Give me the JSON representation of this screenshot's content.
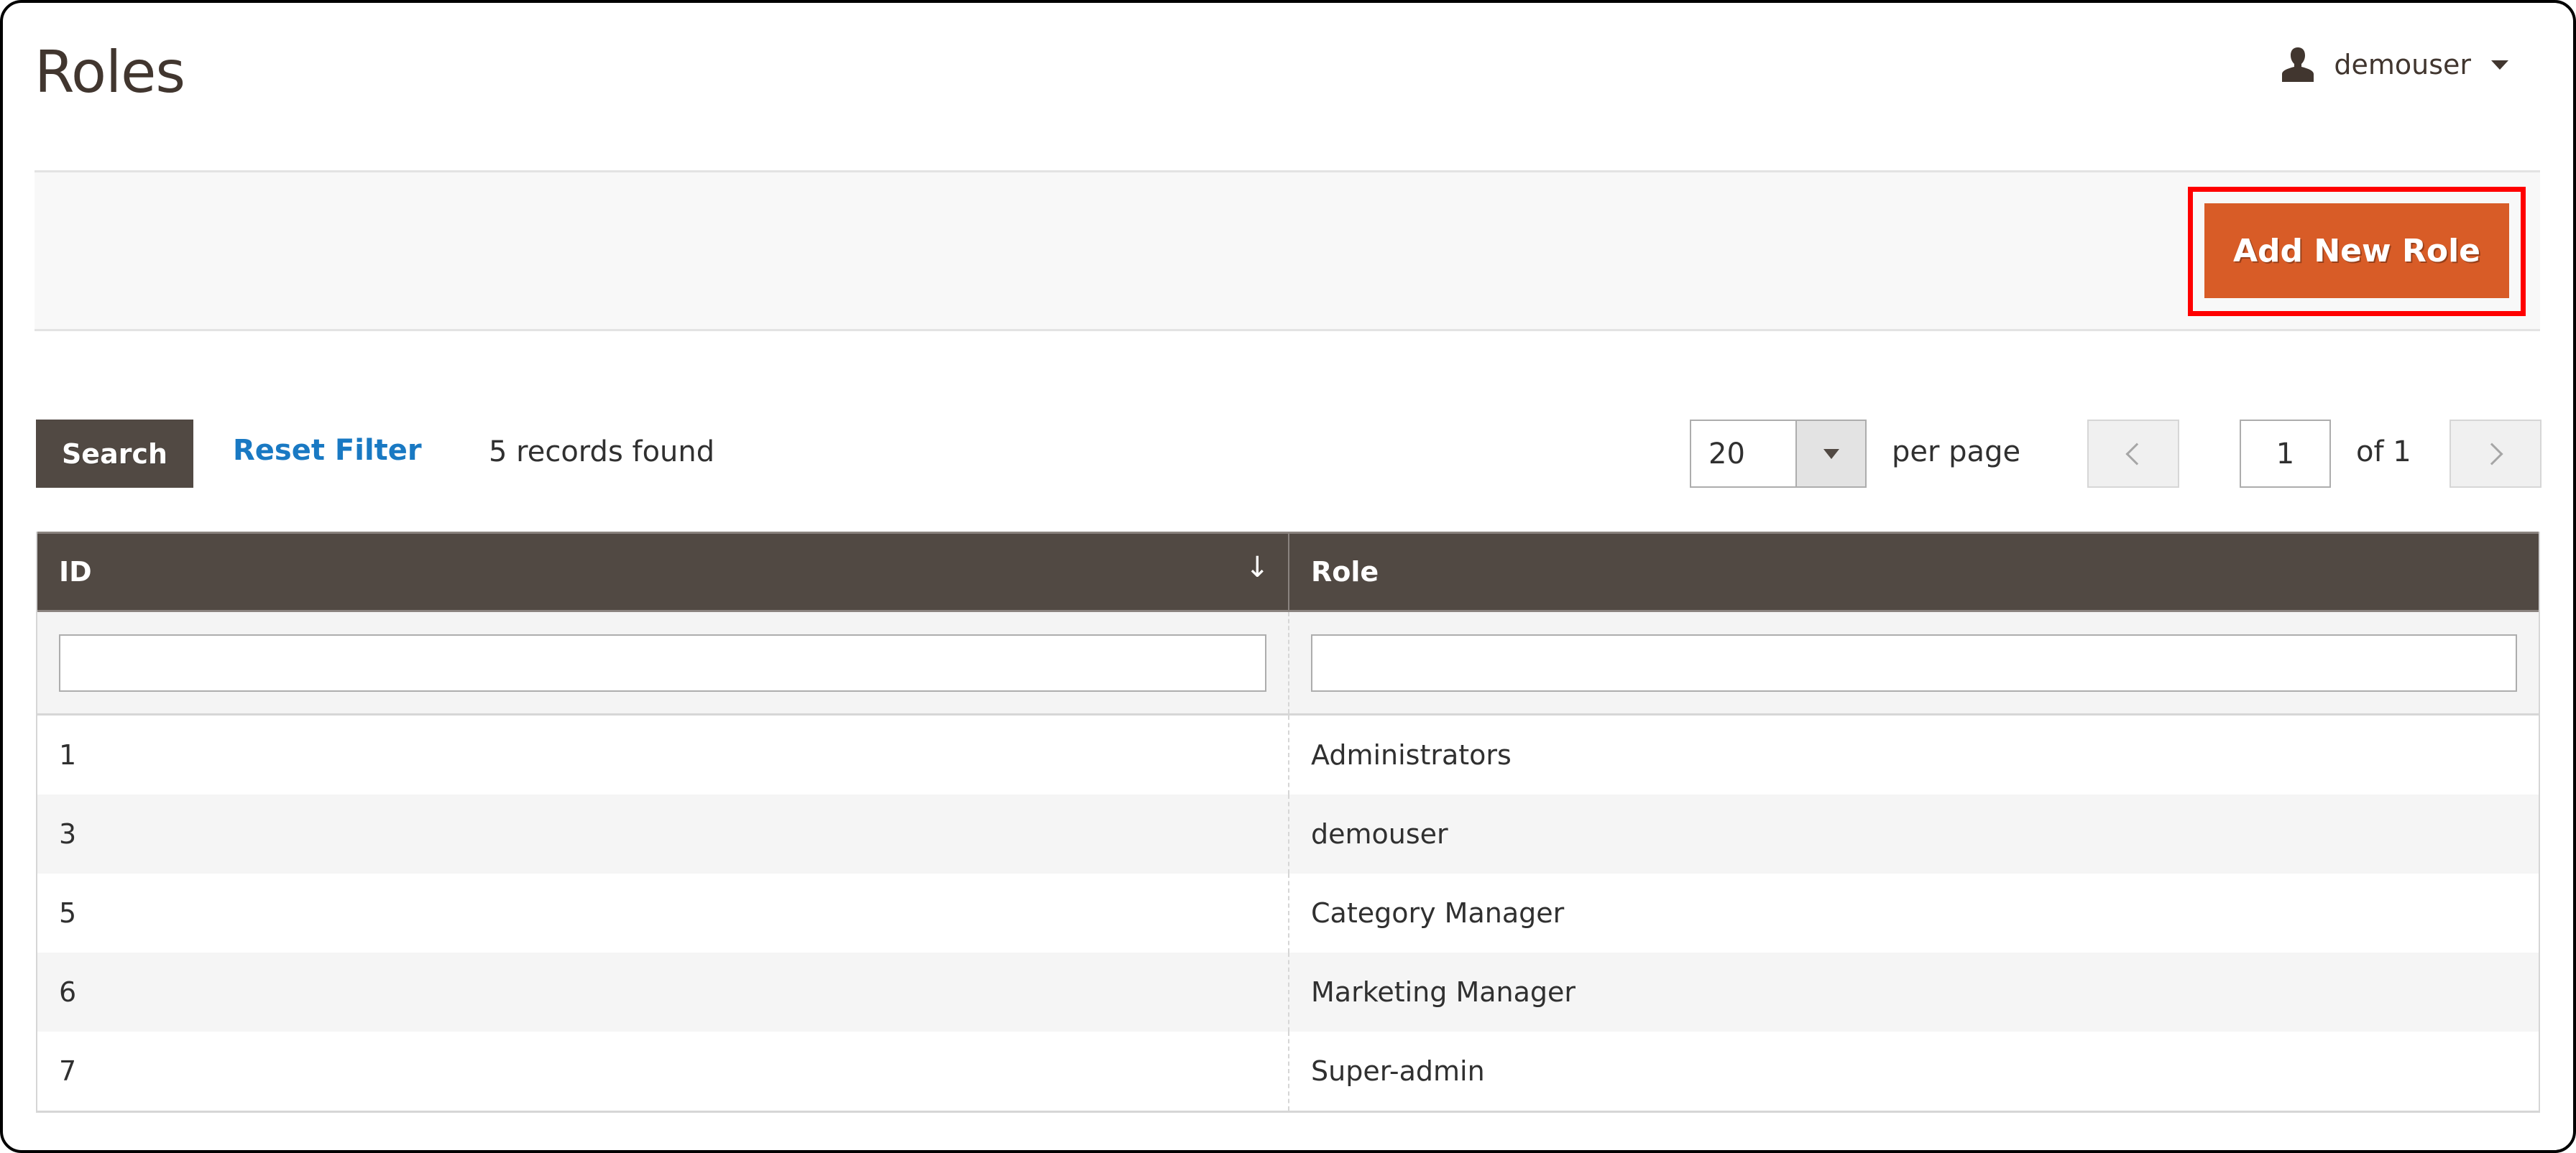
{
  "page": {
    "title": "Roles"
  },
  "user_menu": {
    "username": "demouser",
    "icon": "user-icon"
  },
  "actions": {
    "add_new_role_label": "Add New Role"
  },
  "toolbar": {
    "search_label": "Search",
    "reset_filter_label": "Reset Filter",
    "records_found": "5 records found",
    "per_page_value": "20",
    "per_page_label": "per page",
    "current_page": "1",
    "page_total_label": "of 1"
  },
  "grid": {
    "columns": [
      {
        "label": "ID",
        "sorted": "descending-arrow"
      },
      {
        "label": "Role"
      }
    ],
    "filters": {
      "id_value": "",
      "role_value": ""
    },
    "rows": [
      {
        "id": "1",
        "role": "Administrators"
      },
      {
        "id": "3",
        "role": "demouser"
      },
      {
        "id": "5",
        "role": "Category Manager"
      },
      {
        "id": "6",
        "role": "Marketing Manager"
      },
      {
        "id": "7",
        "role": "Super-admin"
      }
    ]
  },
  "colors": {
    "primary_button": "#d85c27",
    "header_dark": "#514943",
    "link": "#1979c3",
    "highlight_outline": "#ff0000"
  }
}
